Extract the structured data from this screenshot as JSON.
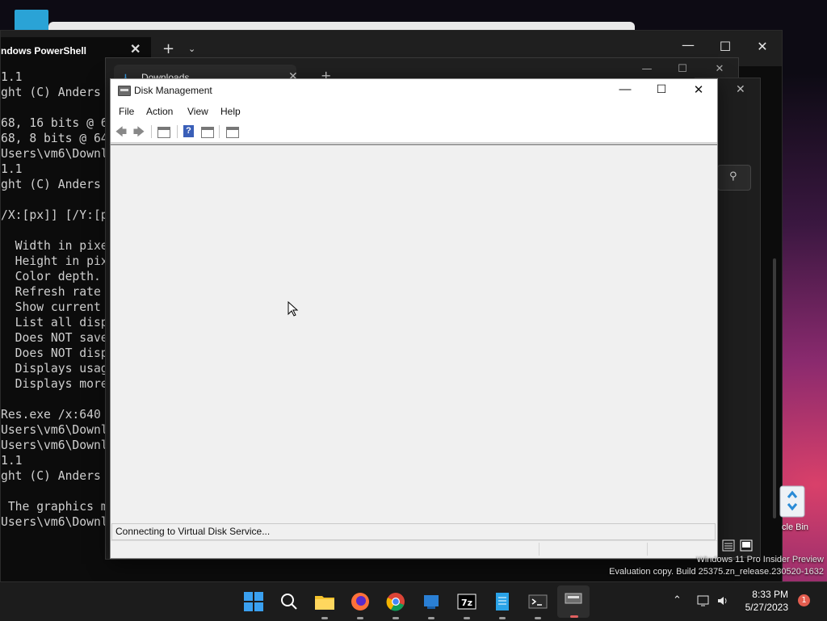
{
  "terminal": {
    "tab_label": "ndows PowerShell",
    "lines": [
      "1.1",
      "ght (C) Anders",
      "",
      "68, 16 bits @ 6",
      "68, 8 bits @ 64",
      "Users\\vm6\\Downl",
      "1.1",
      "ght (C) Anders",
      "",
      "/X:[px]] [/Y:[p",
      "",
      "  Width in pixe",
      "  Height in pix",
      "  Color depth.",
      "  Refresh rate",
      "  Show current",
      "  List all disp",
      "  Does NOT save",
      "  Does NOT disp",
      "  Displays usag",
      "  Displays more",
      "",
      "Res.exe /x:640",
      "Users\\vm6\\Downl",
      "Users\\vm6\\Downl",
      "1.1",
      "ght (C) Anders",
      "",
      " The graphics m",
      "Users\\vm6\\Downl"
    ]
  },
  "explorer": {
    "tab_label": "Downloads"
  },
  "disk_management": {
    "title": "Disk Management",
    "menu": [
      "File",
      "Action",
      "View",
      "Help"
    ],
    "status": "Connecting to Virtual Disk Service..."
  },
  "desktop": {
    "recycle_bin_label": "cle Bin",
    "watermark_line1": "Windows 11 Pro Insider Preview",
    "watermark_line2": "Evaluation copy. Build 25375.zn_release.230520-1632"
  },
  "taskbar": {
    "apps": [
      "start-icon",
      "search-icon",
      "file-explorer-icon",
      "firefox-icon",
      "chrome-icon",
      "hyper-v-icon",
      "7zip-icon",
      "notepad-icon",
      "terminal-icon",
      "disk-management-icon"
    ],
    "time": "8:33 PM",
    "date": "5/27/2023",
    "notification_count": "1"
  }
}
